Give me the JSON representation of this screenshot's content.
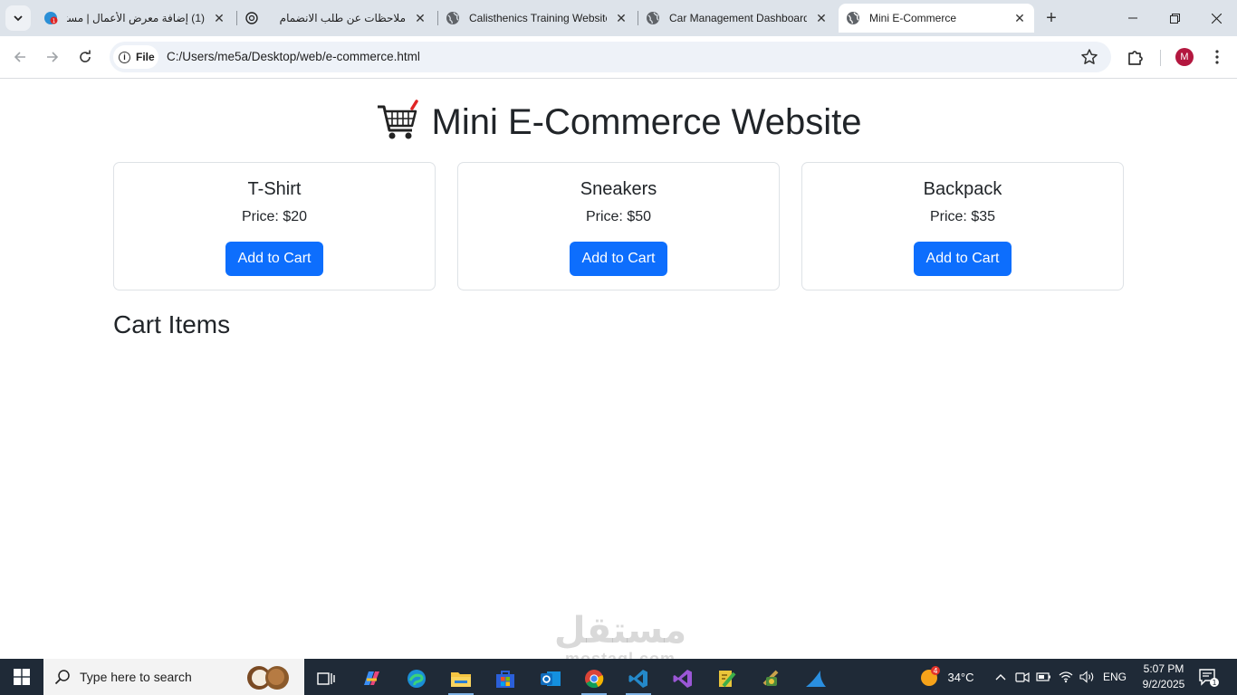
{
  "browser": {
    "tabs": [
      {
        "title": "(1) إضافة معرض الأعمال | مستقل",
        "rtl": true,
        "badge": "1"
      },
      {
        "title": "ملاحظات عن طلب الانضمام",
        "rtl": true
      },
      {
        "title": "Calisthenics Training Website",
        "rtl": false
      },
      {
        "title": "Car Management Dashboard",
        "rtl": false
      },
      {
        "title": "Mini E-Commerce",
        "rtl": false,
        "active": true
      }
    ],
    "omnibox": {
      "scheme_label": "File",
      "url": "C:/Users/me5a/Desktop/web/e-commerce.html"
    },
    "profile_initial": "M"
  },
  "page": {
    "title": "Mini E-Commerce Website",
    "products": [
      {
        "name": "T-Shirt",
        "price_label": "Price: $20",
        "button": "Add to Cart"
      },
      {
        "name": "Sneakers",
        "price_label": "Price: $50",
        "button": "Add to Cart"
      },
      {
        "name": "Backpack",
        "price_label": "Price: $35",
        "button": "Add to Cart"
      }
    ],
    "cart_heading": "Cart Items",
    "accent_color": "#0d6efd"
  },
  "watermark": {
    "arabic": "مستقل",
    "latin": "mostaql.com"
  },
  "taskbar": {
    "search_placeholder": "Type here to search",
    "weather": {
      "temp": "34°C",
      "badge": "4"
    },
    "language": "ENG",
    "time": "5:07 PM",
    "date": "9/2/2025",
    "notification_count": "1"
  }
}
